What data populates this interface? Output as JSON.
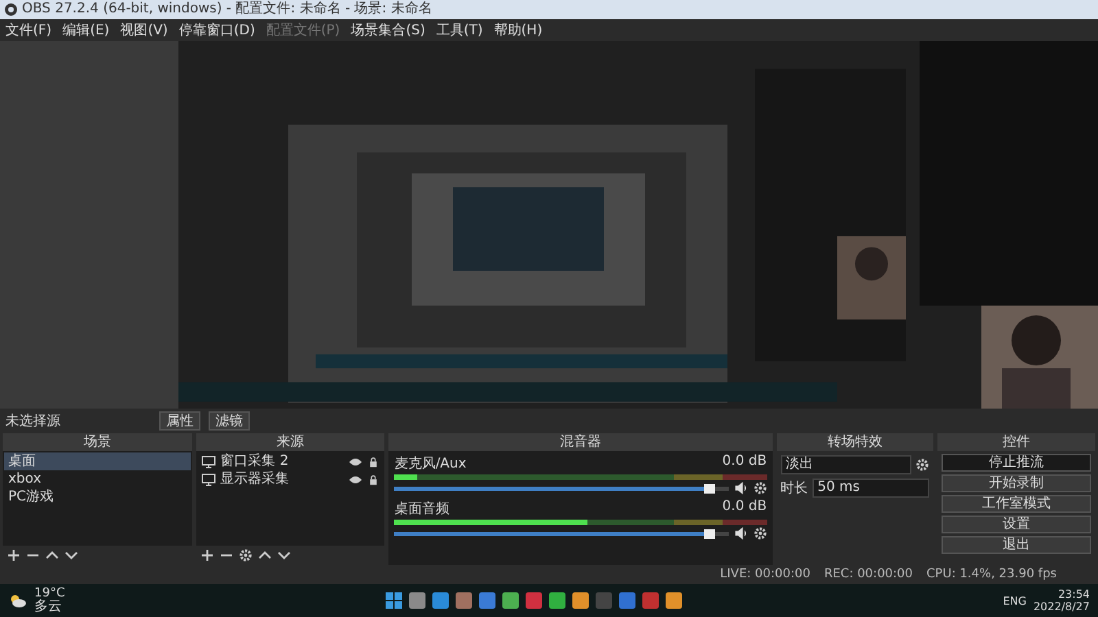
{
  "window": {
    "title": "OBS 27.2.4 (64-bit, windows) - 配置文件: 未命名 - 场景: 未命名"
  },
  "menu": [
    {
      "label": "文件(F)",
      "disabled": false
    },
    {
      "label": "编辑(E)",
      "disabled": false
    },
    {
      "label": "视图(V)",
      "disabled": false
    },
    {
      "label": "停靠窗口(D)",
      "disabled": false
    },
    {
      "label": "配置文件(P)",
      "disabled": true
    },
    {
      "label": "场景集合(S)",
      "disabled": false
    },
    {
      "label": "工具(T)",
      "disabled": false
    },
    {
      "label": "帮助(H)",
      "disabled": false
    }
  ],
  "source_bar": {
    "label": "未选择源",
    "buttons": [
      "属性",
      "滤镜"
    ]
  },
  "scenes": {
    "title": "场景",
    "items": [
      {
        "label": "桌面",
        "selected": true
      },
      {
        "label": "xbox",
        "selected": false
      },
      {
        "label": "PC游戏",
        "selected": false
      }
    ]
  },
  "sources": {
    "title": "来源",
    "items": [
      {
        "label": "窗口采集 2",
        "visible": true
      },
      {
        "label": "显示器采集",
        "visible": true
      }
    ]
  },
  "mixer": {
    "title": "混音器",
    "channels": [
      {
        "name": "麦克风/Aux",
        "reading": "0.0 dB",
        "meter": {
          "level": 0.06
        },
        "volume": {
          "level": 0.96
        }
      },
      {
        "name": "桌面音频",
        "reading": "0.0 dB",
        "meter": {
          "level": 0.52
        },
        "volume": {
          "level": 0.96
        }
      }
    ]
  },
  "transitions": {
    "title": "转场特效",
    "type": "淡出",
    "duration_label": "时长",
    "duration": "50 ms"
  },
  "controls": {
    "title": "控件",
    "buttons": [
      {
        "label": "停止推流",
        "active": true
      },
      {
        "label": "开始录制",
        "active": false
      },
      {
        "label": "工作室模式",
        "active": false
      },
      {
        "label": "设置",
        "active": false
      },
      {
        "label": "退出",
        "active": false
      }
    ]
  },
  "status_bar": {
    "live": "LIVE: 00:00:00",
    "rec": "REC: 00:00:00",
    "cpu": "CPU: 1.4%, 23.90 fps"
  },
  "taskbar": {
    "temperature": "19°C",
    "weather": "多云",
    "language": "ENG",
    "time": "23:54",
    "date": "2022/8/27"
  }
}
